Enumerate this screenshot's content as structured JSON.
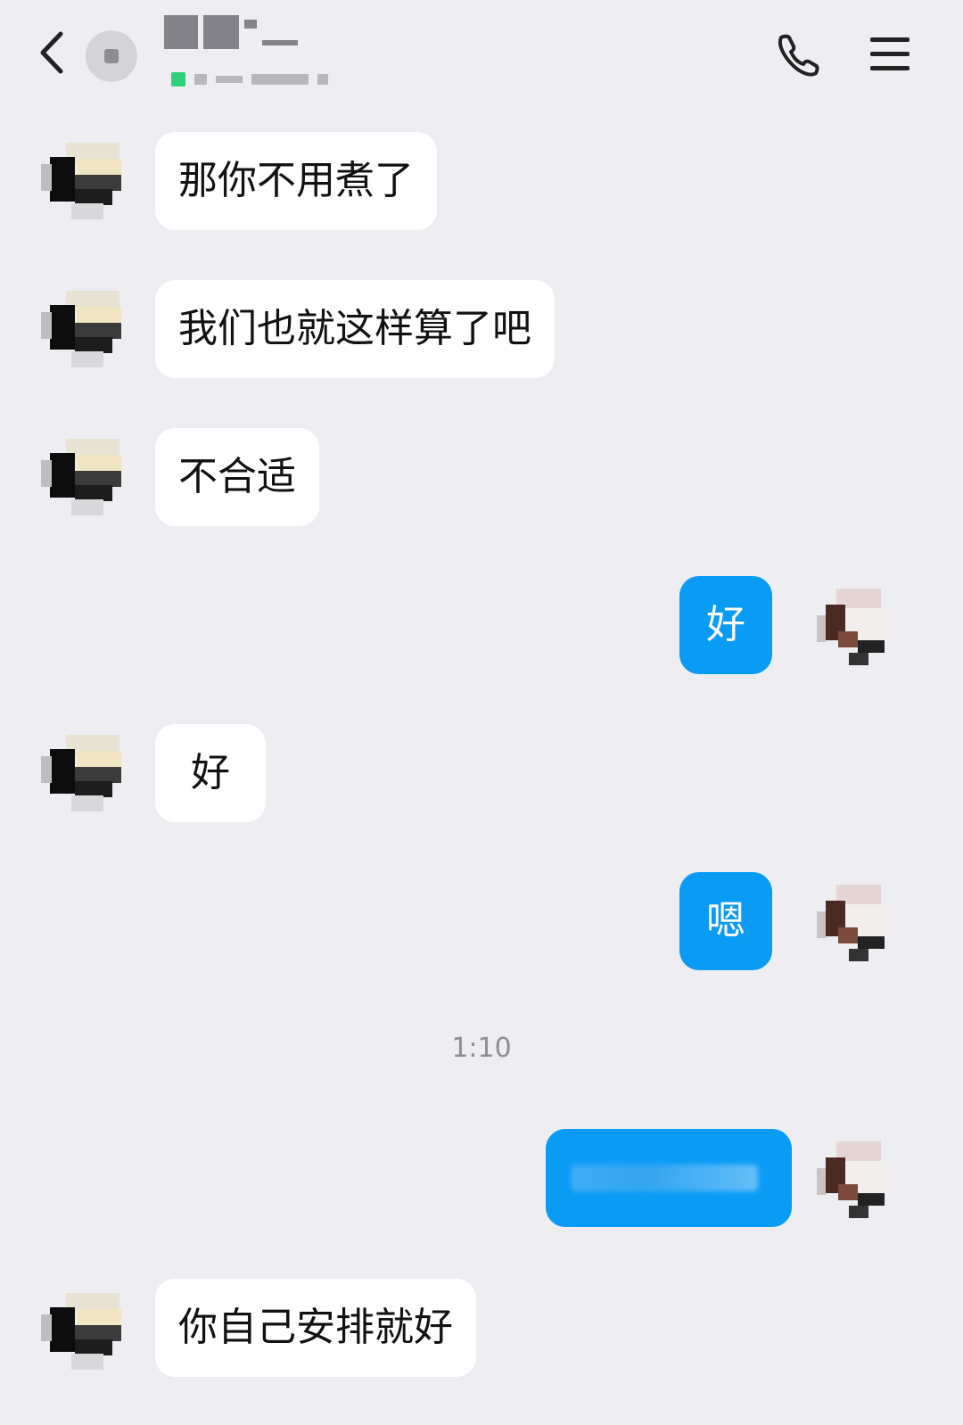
{
  "header": {
    "back_icon": "chevron-left-icon",
    "call_icon": "phone-icon",
    "menu_icon": "hamburger-menu-icon",
    "status_color": "#2fd07a"
  },
  "colors": {
    "background": "#ededf2",
    "incoming_bubble": "#ffffff",
    "outgoing_bubble": "#0a9bf5"
  },
  "messages": [
    {
      "from": "them",
      "text": "那你不用煮了"
    },
    {
      "from": "them",
      "text": "我们也就这样算了吧"
    },
    {
      "from": "them",
      "text": "不合适"
    },
    {
      "from": "me",
      "text": "好"
    },
    {
      "from": "them",
      "text": "好"
    },
    {
      "from": "me",
      "text": "嗯"
    },
    {
      "from": "me",
      "text": ""
    },
    {
      "from": "them",
      "text": "你自己安排就好"
    }
  ],
  "timestamp": "1:10"
}
